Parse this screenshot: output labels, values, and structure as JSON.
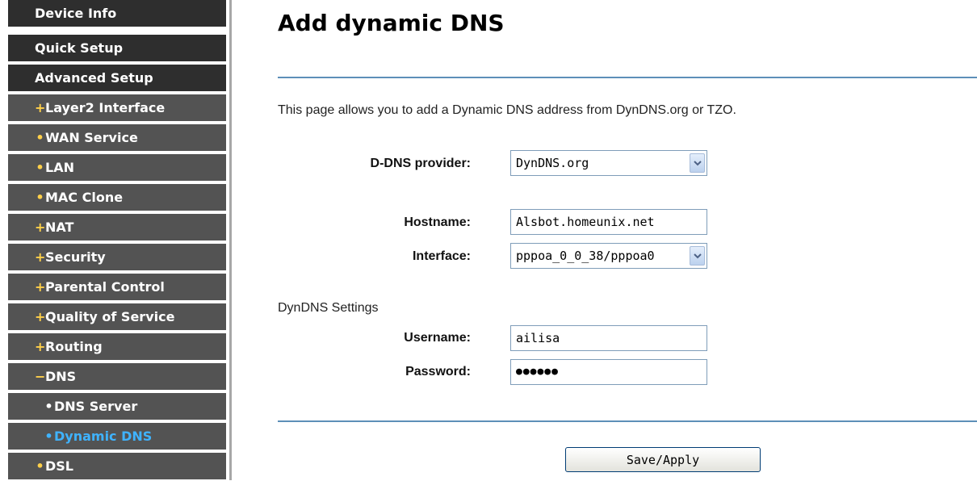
{
  "sidebar": {
    "items": [
      {
        "label": "Device Info",
        "marker": ""
      },
      {
        "label": "Quick Setup",
        "marker": ""
      },
      {
        "label": "Advanced Setup",
        "marker": ""
      },
      {
        "label": "Layer2 Interface",
        "marker": "+"
      },
      {
        "label": "WAN Service",
        "marker": "•"
      },
      {
        "label": "LAN",
        "marker": "•"
      },
      {
        "label": "MAC Clone",
        "marker": "•"
      },
      {
        "label": "NAT",
        "marker": "+"
      },
      {
        "label": "Security",
        "marker": "+"
      },
      {
        "label": "Parental Control",
        "marker": "+"
      },
      {
        "label": "Quality of Service",
        "marker": "+"
      },
      {
        "label": "Routing",
        "marker": "+"
      },
      {
        "label": "DNS",
        "marker": "−"
      },
      {
        "label": "DNS Server",
        "marker": "•"
      },
      {
        "label": "Dynamic DNS",
        "marker": "•"
      },
      {
        "label": "DSL",
        "marker": "•"
      }
    ],
    "active_label": "Dynamic DNS"
  },
  "main": {
    "title": "Add dynamic DNS",
    "description": "This page allows you to add a Dynamic DNS address from DynDNS.org or TZO.",
    "provider": {
      "label": "D-DNS provider:",
      "value": "DynDNS.org"
    },
    "hostname": {
      "label": "Hostname:",
      "value": "Alsbot.homeunix.net"
    },
    "interface": {
      "label": "Interface:",
      "value": "pppoa_0_0_38/pppoa0"
    },
    "dyndns_settings_label": "DynDNS Settings",
    "username": {
      "label": "Username:",
      "value": "ailisa"
    },
    "password": {
      "label": "Password:",
      "masked_value": "●●●●●●"
    },
    "save_label": "Save/Apply"
  },
  "colors": {
    "nav_bg": "#535353",
    "nav_top_bg": "#2e2e2e",
    "active_text": "#3fb3ff",
    "plus_marker": "#ffd04a",
    "rule": "#5d8fb8"
  }
}
